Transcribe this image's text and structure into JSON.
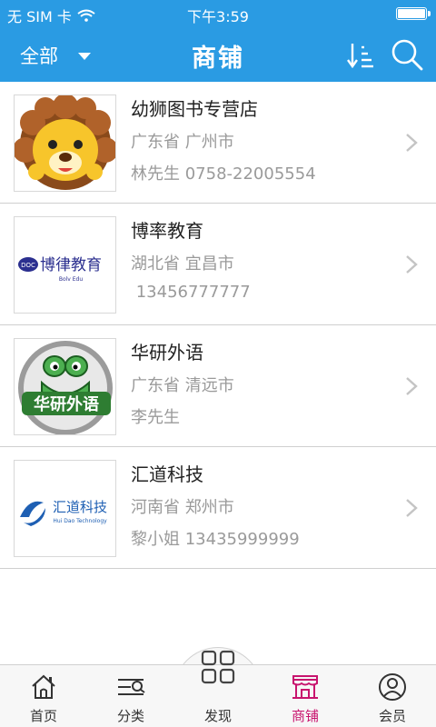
{
  "status_bar": {
    "carrier": "无 SIM 卡",
    "time": "下午3:59"
  },
  "header": {
    "filter_label": "全部",
    "title": "商铺"
  },
  "shops": [
    {
      "name": "幼狮图书专营店",
      "region": "广东省 广州市",
      "contact": "林先生 0758-22005554",
      "logo": "lion-logo"
    },
    {
      "name": "博率教育",
      "region": "湖北省 宜昌市",
      "contact": " 13456777777",
      "logo": "bolv-education-logo",
      "logo_text": "博律教育",
      "logo_subtext": "Bolv Edu"
    },
    {
      "name": "华研外语",
      "region": "广东省 清远市",
      "contact": "李先生",
      "logo": "frog-logo",
      "logo_text": "华研外语"
    },
    {
      "name": "汇道科技",
      "region": "河南省 郑州市",
      "contact": "黎小姐 13435999999",
      "logo": "huidao-logo",
      "logo_text": "汇道科技",
      "logo_subtext": "Hui Dao Technology"
    }
  ],
  "tabs": [
    {
      "label": "首页",
      "icon": "home-icon"
    },
    {
      "label": "分类",
      "icon": "category-icon"
    },
    {
      "label": "发现",
      "icon": "discover-grid-icon"
    },
    {
      "label": "商铺",
      "icon": "shop-icon",
      "active": true
    },
    {
      "label": "会员",
      "icon": "member-icon"
    }
  ],
  "colors": {
    "header_bg": "#2a9be3",
    "active_tab": "#c8146e",
    "secondary_text": "#9a9a9a"
  }
}
